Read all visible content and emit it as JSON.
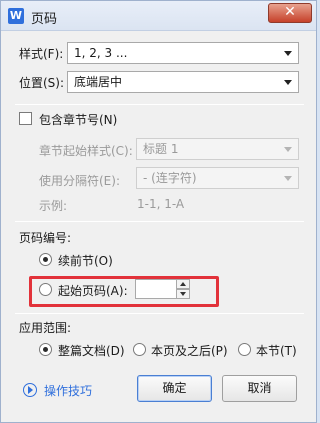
{
  "title": "页码",
  "close_label": "✕",
  "style_row": {
    "label": "样式(F):",
    "value": "1, 2, 3 ..."
  },
  "position_row": {
    "label": "位置(S):",
    "value": "底端居中"
  },
  "include_chapter": {
    "label": "包含章节号(N)",
    "checked": false
  },
  "chapter_start_style": {
    "label": "章节起始样式(C):",
    "value": "标题 1"
  },
  "separator": {
    "label": "使用分隔符(E):",
    "value": "-    (连字符)"
  },
  "example": {
    "label": "示例:",
    "value": "1-1, 1-A"
  },
  "numbering": {
    "heading": "页码编号:",
    "continue_label": "续前节(O)",
    "start_at_label": "起始页码(A):",
    "start_at_value": ""
  },
  "apply": {
    "heading": "应用范围:",
    "whole_doc": "整篇文档(D)",
    "this_and_after": "本页及之后(P)",
    "this_section": "本节(T)"
  },
  "footer": {
    "tips_label": "操作技巧",
    "ok_label": "确定",
    "cancel_label": "取消"
  },
  "colors": {
    "accent": "#2f6fdc",
    "highlight": "#e2323a"
  }
}
